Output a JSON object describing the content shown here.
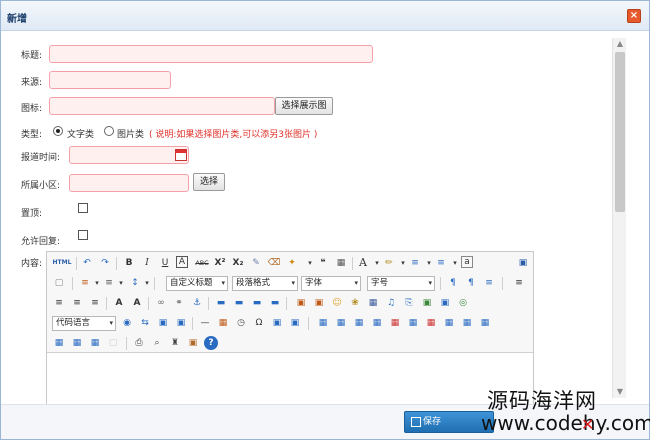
{
  "dialog": {
    "title": "新增",
    "close_glyph": "×"
  },
  "form": {
    "title_label": "标题:",
    "source_label": "来源:",
    "icon_label": "图标:",
    "icon_button": "选择展示图",
    "type_label": "类型:",
    "type_options": [
      "文字类",
      "图片类"
    ],
    "type_selected": "文字类",
    "type_hint": "( 说明:如果选择图片类,可以添另3张图片 )",
    "report_time_label": "报道时间:",
    "community_label": "所属小区:",
    "community_button": "选择",
    "pinned_label": "置顶:",
    "allow_reply_label": "允许回复:",
    "content_label": "内容:"
  },
  "editor": {
    "toolbar_selects": {
      "custom_title": "自定义标题",
      "paragraph_format": "段落格式",
      "font_family": "字体",
      "font_size": "字号",
      "code_language": "代码语言"
    },
    "row1": [
      "HTML",
      "↶",
      "↷",
      "B",
      "I",
      "U",
      "A",
      "ABC",
      "X²",
      "X₂",
      "✎",
      "⌫",
      "✦",
      "❝",
      "▦",
      "A",
      "✏",
      "≡",
      "≡",
      "a",
      "▣"
    ],
    "row2": [
      "▢",
      "≡",
      "≡",
      "↕",
      "¶",
      "¶",
      "≡",
      "≡"
    ],
    "row3": [
      "≡",
      "≡",
      "≡",
      "A",
      "A",
      "∞",
      "⚭",
      "⚓",
      "▬",
      "▬",
      "▬",
      "▬",
      "▣",
      "▣",
      "☺",
      "❀",
      "▦",
      "♫",
      "⎘",
      "▣",
      "▣",
      "◎"
    ],
    "row4": [
      "◉",
      "⇆",
      "▣",
      "▣",
      "—",
      "▦",
      "◷",
      "Ω",
      "▣",
      "▣",
      "▦",
      "▦",
      "▦",
      "▦",
      "▦",
      "▦",
      "▦",
      "▦"
    ],
    "row5": [
      "▦",
      "▦",
      "▦",
      "▢",
      "⎙",
      "⌕",
      "♜",
      "▣",
      "?"
    ]
  },
  "footer": {
    "save_label": "保存"
  },
  "watermark": {
    "site_cn": "源码海洋网",
    "site_url": "www.codehy.com",
    "red_mark": "✕"
  },
  "colors": {
    "accent": "#1f6fb2",
    "input_border": "#f3a0a8",
    "input_bg": "#fff0f0",
    "hint": "#e0302a",
    "close": "#e65a2d"
  }
}
